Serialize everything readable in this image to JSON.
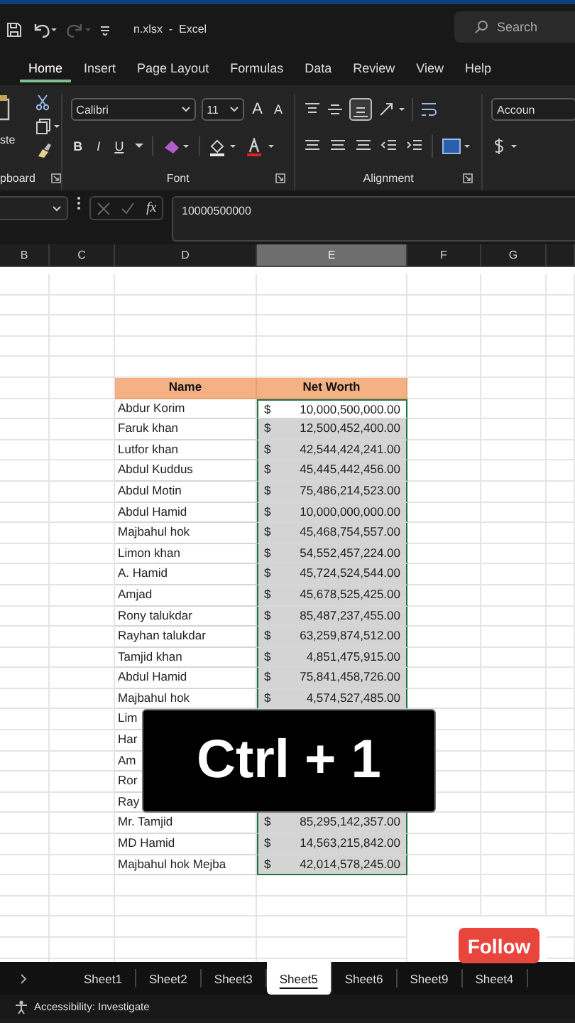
{
  "title_bar": {
    "title": "n.xlsx  -  Excel",
    "search": {
      "placeholder": "Search"
    },
    "redo_disabled": true
  },
  "ribbon_tabs": [
    {
      "label": "Home",
      "selected": true
    },
    {
      "label": "Insert",
      "selected": false
    },
    {
      "label": "Page Layout",
      "selected": false
    },
    {
      "label": "Formulas",
      "selected": false
    },
    {
      "label": "Data",
      "selected": false
    },
    {
      "label": "Review",
      "selected": false
    },
    {
      "label": "View",
      "selected": false
    },
    {
      "label": "Help",
      "selected": false
    }
  ],
  "ribbon": {
    "clipboard": {
      "paste_label": "ste",
      "group_label": "pboard"
    },
    "font": {
      "name": "Calibri",
      "size": "11",
      "grow": "A",
      "shrink": "A",
      "styles": [
        "B",
        "I",
        "U"
      ],
      "group_label": "Font"
    },
    "alignment": {
      "group_label": "Alignment"
    },
    "number": {
      "format": "Accoun"
    }
  },
  "formula_bar": {
    "function_label": "fx",
    "value": "10000500000"
  },
  "column_headers": [
    {
      "label": "B",
      "selected": false
    },
    {
      "label": "C",
      "selected": false
    },
    {
      "label": "D",
      "selected": false
    },
    {
      "label": "E",
      "selected": true
    },
    {
      "label": "F",
      "selected": false
    },
    {
      "label": "G",
      "selected": false
    }
  ],
  "table": {
    "columns": [
      "Name",
      "Net Worth"
    ],
    "rows": [
      {
        "name": "Abdur Korim",
        "currency": "$",
        "value": "10,000,500,000.00",
        "selected": true,
        "active": true
      },
      {
        "name": "Faruk khan",
        "currency": "$",
        "value": "12,500,452,400.00",
        "selected": true,
        "active": false
      },
      {
        "name": "Lutfor khan",
        "currency": "$",
        "value": "42,544,424,241.00",
        "selected": true,
        "active": false
      },
      {
        "name": "Abdul Kuddus",
        "currency": "$",
        "value": "45,445,442,456.00",
        "selected": true,
        "active": false
      },
      {
        "name": "Abdul Motin",
        "currency": "$",
        "value": "75,486,214,523.00",
        "selected": true,
        "active": false
      },
      {
        "name": "Abdul Hamid",
        "currency": "$",
        "value": "10,000,000,000.00",
        "selected": true,
        "active": false
      },
      {
        "name": "Majbahul hok",
        "currency": "$",
        "value": "45,468,754,557.00",
        "selected": true,
        "active": false
      },
      {
        "name": "Limon khan",
        "currency": "$",
        "value": "54,552,457,224.00",
        "selected": true,
        "active": false
      },
      {
        "name": "A. Hamid",
        "currency": "$",
        "value": "45,724,524,544.00",
        "selected": true,
        "active": false
      },
      {
        "name": "Amjad",
        "currency": "$",
        "value": "45,678,525,425.00",
        "selected": true,
        "active": false
      },
      {
        "name": "Rony talukdar",
        "currency": "$",
        "value": "85,487,237,455.00",
        "selected": true,
        "active": false
      },
      {
        "name": "Rayhan talukdar",
        "currency": "$",
        "value": "63,259,874,512.00",
        "selected": true,
        "active": false
      },
      {
        "name": "Tamjid khan",
        "currency": "$",
        "value": "4,851,475,915.00",
        "selected": true,
        "active": false
      },
      {
        "name": "Abdul Hamid",
        "currency": "$",
        "value": "75,841,458,726.00",
        "selected": true,
        "active": false
      },
      {
        "name": "Majbahul hok",
        "currency": "$",
        "value": "4,574,527,485.00",
        "selected": true,
        "active": false
      },
      {
        "name": "Lim"
      },
      {
        "name": "Har"
      },
      {
        "name": "Am"
      },
      {
        "name": "Ror"
      },
      {
        "name": "Ray"
      },
      {
        "name": "Mr. Tamjid",
        "currency": "$",
        "value": "85,295,142,357.00",
        "selected": true,
        "active": false
      },
      {
        "name": "MD Hamid",
        "currency": "$",
        "value": "14,563,215,842.00",
        "selected": true,
        "active": false
      },
      {
        "name": "Majbahul hok Mejba",
        "currency": "$",
        "value": "42,014,578,245.00",
        "selected": true,
        "active": false
      }
    ]
  },
  "overlay_caption": "Ctrl + 1",
  "follow_button": "Follow",
  "sheet_tabs": [
    {
      "label": "Sheet1",
      "selected": false
    },
    {
      "label": "Sheet2",
      "selected": false
    },
    {
      "label": "Sheet3",
      "selected": false
    },
    {
      "label": "Sheet5",
      "selected": true
    },
    {
      "label": "Sheet6",
      "selected": false
    },
    {
      "label": "Sheet9",
      "selected": false
    },
    {
      "label": "Sheet4",
      "selected": false
    }
  ],
  "status_bar": {
    "accessibility": "Accessibility: Investigate"
  }
}
